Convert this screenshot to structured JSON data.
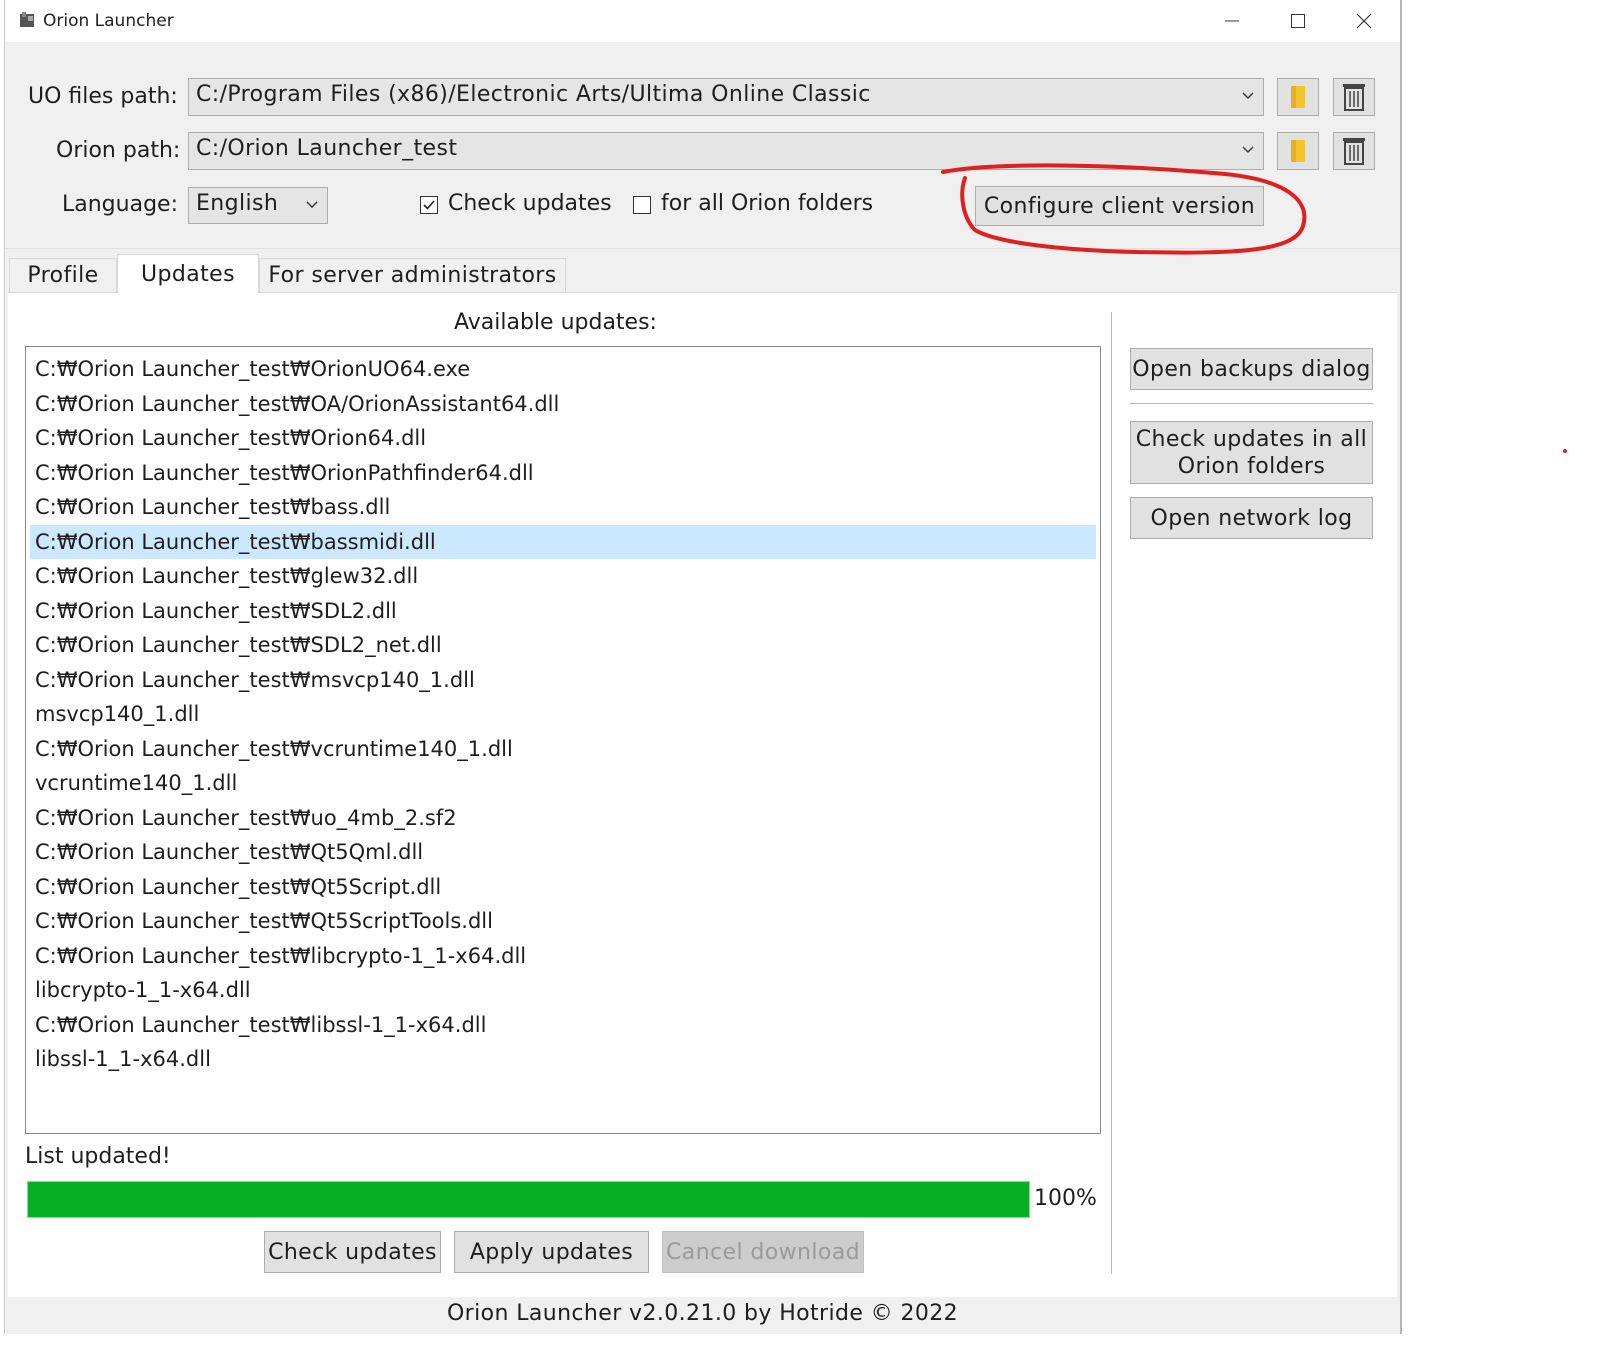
{
  "window": {
    "title": "Orion Launcher"
  },
  "colors": {
    "progress_fill": "#06b025",
    "selection": "#cce8ff",
    "annotation": "#e02020"
  },
  "settings": {
    "uo_path_label": "UO files path:",
    "uo_path_value": "C:/Program Files (x86)/Electronic Arts/Ultima Online Classic",
    "orion_path_label": "Orion path:",
    "orion_path_value": "C:/Orion Launcher_test",
    "language_label": "Language:",
    "language_value": "English",
    "check_updates_label": "Check updates",
    "check_updates_checked": true,
    "all_folders_label": "for all Orion folders",
    "all_folders_checked": false,
    "configure_button": "Configure client version"
  },
  "tabs": [
    {
      "label": "Profile",
      "active": false
    },
    {
      "label": "Updates",
      "active": true
    },
    {
      "label": "For server administrators",
      "active": false
    }
  ],
  "updates": {
    "heading": "Available updates:",
    "items": [
      "C:₩Orion Launcher_test₩OrionUO64.exe",
      "C:₩Orion Launcher_test₩OA/OrionAssistant64.dll",
      "C:₩Orion Launcher_test₩Orion64.dll",
      "C:₩Orion Launcher_test₩OrionPathfinder64.dll",
      "C:₩Orion Launcher_test₩bass.dll",
      "C:₩Orion Launcher_test₩bassmidi.dll",
      "C:₩Orion Launcher_test₩glew32.dll",
      "C:₩Orion Launcher_test₩SDL2.dll",
      "C:₩Orion Launcher_test₩SDL2_net.dll",
      "C:₩Orion Launcher_test₩msvcp140_1.dll",
      "msvcp140_1.dll",
      "C:₩Orion Launcher_test₩vcruntime140_1.dll",
      "vcruntime140_1.dll",
      "C:₩Orion Launcher_test₩uo_4mb_2.sf2",
      "C:₩Orion Launcher_test₩Qt5Qml.dll",
      "C:₩Orion Launcher_test₩Qt5Script.dll",
      "C:₩Orion Launcher_test₩Qt5ScriptTools.dll",
      "C:₩Orion Launcher_test₩libcrypto-1_1-x64.dll",
      "libcrypto-1_1-x64.dll",
      "C:₩Orion Launcher_test₩libssl-1_1-x64.dll",
      "libssl-1_1-x64.dll"
    ],
    "selected_item": "C:₩Orion Launcher_test₩bassmidi.dll",
    "status_text": "List updated!",
    "progress_fraction": 1.0,
    "progress_text": "100%",
    "check_button": "Check updates",
    "apply_button": "Apply updates",
    "cancel_button": "Cancel download"
  },
  "side_buttons": {
    "backups": "Open backups dialog",
    "check_all": "Check updates in all Orion folders",
    "network_log": "Open network log"
  },
  "footer": "Orion Launcher v2.0.21.0 by Hotride © 2022",
  "icons": [
    "app-icon",
    "minimize-icon",
    "maximize-icon",
    "close-icon",
    "folder-icon",
    "trash-icon",
    "chevron-down-icon",
    "checkbox-icon"
  ]
}
